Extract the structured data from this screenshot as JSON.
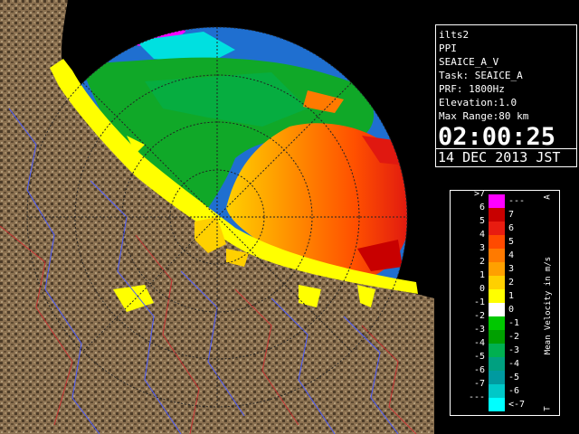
{
  "info": {
    "site": "ilts2",
    "mode": "PPI",
    "product": "SEAICE_A_V",
    "task": "Task: SEAICE_A",
    "prf": "PRF: 1800Hz",
    "elevation": "Elevation:1.0",
    "max_range": "Max Range:80 km",
    "time": "02:00:25",
    "date": "14 DEC 2013 JST"
  },
  "legend": {
    "unit_label": "Mean Velocity in m/s",
    "top_marker": "A",
    "bottom_marker": "T",
    "rows": [
      {
        "left": ">7",
        "right": "---",
        "color": "#ff00ff"
      },
      {
        "left": "6",
        "right": "7",
        "color": "#c80000"
      },
      {
        "left": "5",
        "right": "6",
        "color": "#e81c10"
      },
      {
        "left": "4",
        "right": "5",
        "color": "#ff4a00"
      },
      {
        "left": "3",
        "right": "4",
        "color": "#ff7a00"
      },
      {
        "left": "2",
        "right": "3",
        "color": "#ffa000"
      },
      {
        "left": "1",
        "right": "2",
        "color": "#ffd000"
      },
      {
        "left": "0",
        "right": "1",
        "color": "#ffff00"
      },
      {
        "left": "-1",
        "right": "0",
        "color": "#ffffff"
      },
      {
        "left": "-2",
        "right": "-1",
        "color": "#00c800"
      },
      {
        "left": "-3",
        "right": "-2",
        "color": "#00a000"
      },
      {
        "left": "-4",
        "right": "-3",
        "color": "#00b050"
      },
      {
        "left": "-5",
        "right": "-4",
        "color": "#00a080"
      },
      {
        "left": "-6",
        "right": "-5",
        "color": "#009aa0"
      },
      {
        "left": "-7",
        "right": "-6",
        "color": "#00c8c8"
      },
      {
        "left": "---",
        "right": "<-7",
        "color": "#00ffff"
      }
    ]
  },
  "colors": {
    "sea": "#1f6fd0",
    "terrain": "#8a7050",
    "terrain_dark": "#4d3c28",
    "coast_echo": "#ffff00",
    "range_ring": "#222222",
    "river": "#4c5cff",
    "boundary": "#c83232"
  }
}
